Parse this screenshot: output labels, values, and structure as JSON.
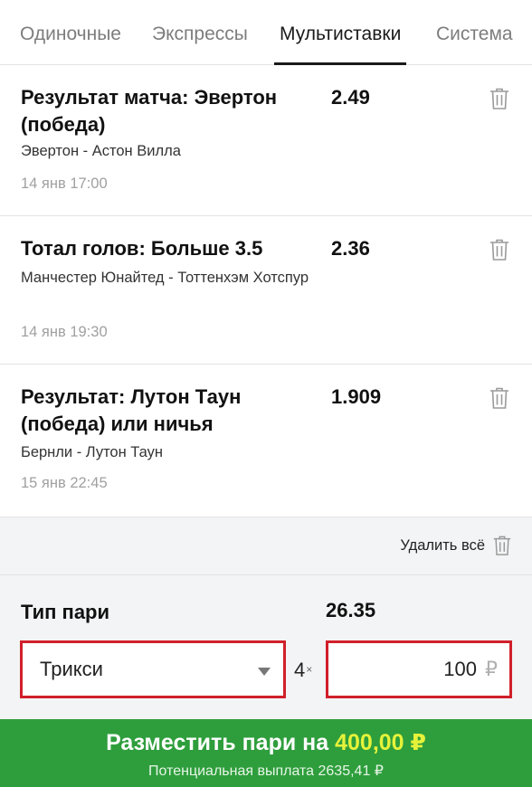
{
  "tabs": [
    {
      "label": "Одиночные",
      "active": false
    },
    {
      "label": "Экспрессы",
      "active": false
    },
    {
      "label": "Мультиставки",
      "active": true
    },
    {
      "label": "Система",
      "active": false
    }
  ],
  "bets": [
    {
      "title": "Результат матча: Эвертон (победа)",
      "odds": "2.49",
      "match": "Эвертон - Астон Вилла",
      "time": "14 янв 17:00"
    },
    {
      "title": "Тотал голов: Больше 3.5",
      "odds": "2.36",
      "match": "Манчестер Юнайтед - Тоттенхэм Хотспур",
      "time": "14 янв 19:30"
    },
    {
      "title": "Результат: Лутон Таун (победа) или ничья",
      "odds": "1.909",
      "match": "Бернли - Лутон Таун",
      "time": "15 янв 22:45"
    }
  ],
  "remove_all": {
    "label": "Удалить всё",
    "icon": "trash-icon"
  },
  "bet_type": {
    "label": "Тип пари",
    "total_odds": "26.35",
    "selected": "Трикси",
    "multiplier": "4",
    "multiplier_sign": "×",
    "amount": "100",
    "currency": "₽"
  },
  "place_button": {
    "label": "Разместить пари на",
    "amount": "400,00 ₽",
    "potential": "Потенциальная выплата 2635,41 ₽"
  },
  "colors": {
    "accent_green": "#2e9e3c",
    "amount_yellow": "#e6f23a",
    "highlight_red": "#d0202a",
    "panel_bg": "#f3f4f5"
  }
}
